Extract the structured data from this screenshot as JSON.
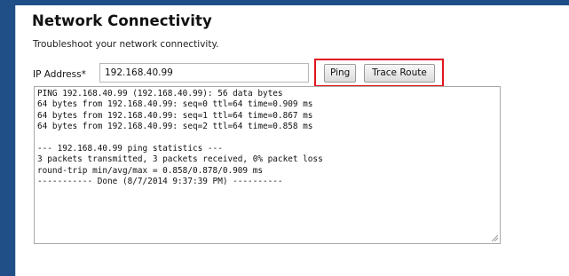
{
  "page": {
    "title": "Network Connectivity",
    "subtitle": "Troubleshoot your network connectivity."
  },
  "form": {
    "ip_label": "IP Address*",
    "ip_value": "192.168.40.99",
    "ping_label": "Ping",
    "trace_label": "Trace Route"
  },
  "output": {
    "lines": [
      "PING 192.168.40.99 (192.168.40.99): 56 data bytes",
      "64 bytes from 192.168.40.99: seq=0 ttl=64 time=0.909 ms",
      "64 bytes from 192.168.40.99: seq=1 ttl=64 time=0.867 ms",
      "64 bytes from 192.168.40.99: seq=2 ttl=64 time=0.858 ms",
      "",
      "--- 192.168.40.99 ping statistics ---",
      "3 packets transmitted, 3 packets received, 0% packet loss",
      "round-trip min/avg/max = 0.858/0.878/0.909 ms",
      "----------- Done (8/7/2014 9:37:39 PM) ----------"
    ]
  },
  "icons": {
    "resize": "resize-grip-icon"
  },
  "colors": {
    "frame_blue": "#1f4f86",
    "highlight_red": "#e0141e"
  }
}
